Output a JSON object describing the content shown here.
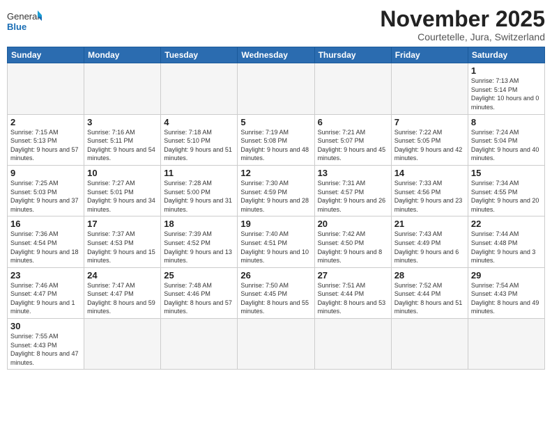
{
  "logo": {
    "text_general": "General",
    "text_blue": "Blue"
  },
  "title": "November 2025",
  "subtitle": "Courtetelle, Jura, Switzerland",
  "days_of_week": [
    "Sunday",
    "Monday",
    "Tuesday",
    "Wednesday",
    "Thursday",
    "Friday",
    "Saturday"
  ],
  "weeks": [
    [
      {
        "day": "",
        "info": "",
        "empty": true
      },
      {
        "day": "",
        "info": "",
        "empty": true
      },
      {
        "day": "",
        "info": "",
        "empty": true
      },
      {
        "day": "",
        "info": "",
        "empty": true
      },
      {
        "day": "",
        "info": "",
        "empty": true
      },
      {
        "day": "",
        "info": "",
        "empty": true
      },
      {
        "day": "1",
        "info": "Sunrise: 7:13 AM\nSunset: 5:14 PM\nDaylight: 10 hours\nand 0 minutes.",
        "empty": false
      }
    ],
    [
      {
        "day": "2",
        "info": "Sunrise: 7:15 AM\nSunset: 5:13 PM\nDaylight: 9 hours\nand 57 minutes.",
        "empty": false
      },
      {
        "day": "3",
        "info": "Sunrise: 7:16 AM\nSunset: 5:11 PM\nDaylight: 9 hours\nand 54 minutes.",
        "empty": false
      },
      {
        "day": "4",
        "info": "Sunrise: 7:18 AM\nSunset: 5:10 PM\nDaylight: 9 hours\nand 51 minutes.",
        "empty": false
      },
      {
        "day": "5",
        "info": "Sunrise: 7:19 AM\nSunset: 5:08 PM\nDaylight: 9 hours\nand 48 minutes.",
        "empty": false
      },
      {
        "day": "6",
        "info": "Sunrise: 7:21 AM\nSunset: 5:07 PM\nDaylight: 9 hours\nand 45 minutes.",
        "empty": false
      },
      {
        "day": "7",
        "info": "Sunrise: 7:22 AM\nSunset: 5:05 PM\nDaylight: 9 hours\nand 42 minutes.",
        "empty": false
      },
      {
        "day": "8",
        "info": "Sunrise: 7:24 AM\nSunset: 5:04 PM\nDaylight: 9 hours\nand 40 minutes.",
        "empty": false
      }
    ],
    [
      {
        "day": "9",
        "info": "Sunrise: 7:25 AM\nSunset: 5:03 PM\nDaylight: 9 hours\nand 37 minutes.",
        "empty": false
      },
      {
        "day": "10",
        "info": "Sunrise: 7:27 AM\nSunset: 5:01 PM\nDaylight: 9 hours\nand 34 minutes.",
        "empty": false
      },
      {
        "day": "11",
        "info": "Sunrise: 7:28 AM\nSunset: 5:00 PM\nDaylight: 9 hours\nand 31 minutes.",
        "empty": false
      },
      {
        "day": "12",
        "info": "Sunrise: 7:30 AM\nSunset: 4:59 PM\nDaylight: 9 hours\nand 28 minutes.",
        "empty": false
      },
      {
        "day": "13",
        "info": "Sunrise: 7:31 AM\nSunset: 4:57 PM\nDaylight: 9 hours\nand 26 minutes.",
        "empty": false
      },
      {
        "day": "14",
        "info": "Sunrise: 7:33 AM\nSunset: 4:56 PM\nDaylight: 9 hours\nand 23 minutes.",
        "empty": false
      },
      {
        "day": "15",
        "info": "Sunrise: 7:34 AM\nSunset: 4:55 PM\nDaylight: 9 hours\nand 20 minutes.",
        "empty": false
      }
    ],
    [
      {
        "day": "16",
        "info": "Sunrise: 7:36 AM\nSunset: 4:54 PM\nDaylight: 9 hours\nand 18 minutes.",
        "empty": false
      },
      {
        "day": "17",
        "info": "Sunrise: 7:37 AM\nSunset: 4:53 PM\nDaylight: 9 hours\nand 15 minutes.",
        "empty": false
      },
      {
        "day": "18",
        "info": "Sunrise: 7:39 AM\nSunset: 4:52 PM\nDaylight: 9 hours\nand 13 minutes.",
        "empty": false
      },
      {
        "day": "19",
        "info": "Sunrise: 7:40 AM\nSunset: 4:51 PM\nDaylight: 9 hours\nand 10 minutes.",
        "empty": false
      },
      {
        "day": "20",
        "info": "Sunrise: 7:42 AM\nSunset: 4:50 PM\nDaylight: 9 hours\nand 8 minutes.",
        "empty": false
      },
      {
        "day": "21",
        "info": "Sunrise: 7:43 AM\nSunset: 4:49 PM\nDaylight: 9 hours\nand 6 minutes.",
        "empty": false
      },
      {
        "day": "22",
        "info": "Sunrise: 7:44 AM\nSunset: 4:48 PM\nDaylight: 9 hours\nand 3 minutes.",
        "empty": false
      }
    ],
    [
      {
        "day": "23",
        "info": "Sunrise: 7:46 AM\nSunset: 4:47 PM\nDaylight: 9 hours\nand 1 minute.",
        "empty": false
      },
      {
        "day": "24",
        "info": "Sunrise: 7:47 AM\nSunset: 4:47 PM\nDaylight: 8 hours\nand 59 minutes.",
        "empty": false
      },
      {
        "day": "25",
        "info": "Sunrise: 7:48 AM\nSunset: 4:46 PM\nDaylight: 8 hours\nand 57 minutes.",
        "empty": false
      },
      {
        "day": "26",
        "info": "Sunrise: 7:50 AM\nSunset: 4:45 PM\nDaylight: 8 hours\nand 55 minutes.",
        "empty": false
      },
      {
        "day": "27",
        "info": "Sunrise: 7:51 AM\nSunset: 4:44 PM\nDaylight: 8 hours\nand 53 minutes.",
        "empty": false
      },
      {
        "day": "28",
        "info": "Sunrise: 7:52 AM\nSunset: 4:44 PM\nDaylight: 8 hours\nand 51 minutes.",
        "empty": false
      },
      {
        "day": "29",
        "info": "Sunrise: 7:54 AM\nSunset: 4:43 PM\nDaylight: 8 hours\nand 49 minutes.",
        "empty": false
      }
    ],
    [
      {
        "day": "30",
        "info": "Sunrise: 7:55 AM\nSunset: 4:43 PM\nDaylight: 8 hours\nand 47 minutes.",
        "empty": false
      },
      {
        "day": "",
        "info": "",
        "empty": true
      },
      {
        "day": "",
        "info": "",
        "empty": true
      },
      {
        "day": "",
        "info": "",
        "empty": true
      },
      {
        "day": "",
        "info": "",
        "empty": true
      },
      {
        "day": "",
        "info": "",
        "empty": true
      },
      {
        "day": "",
        "info": "",
        "empty": true
      }
    ]
  ]
}
